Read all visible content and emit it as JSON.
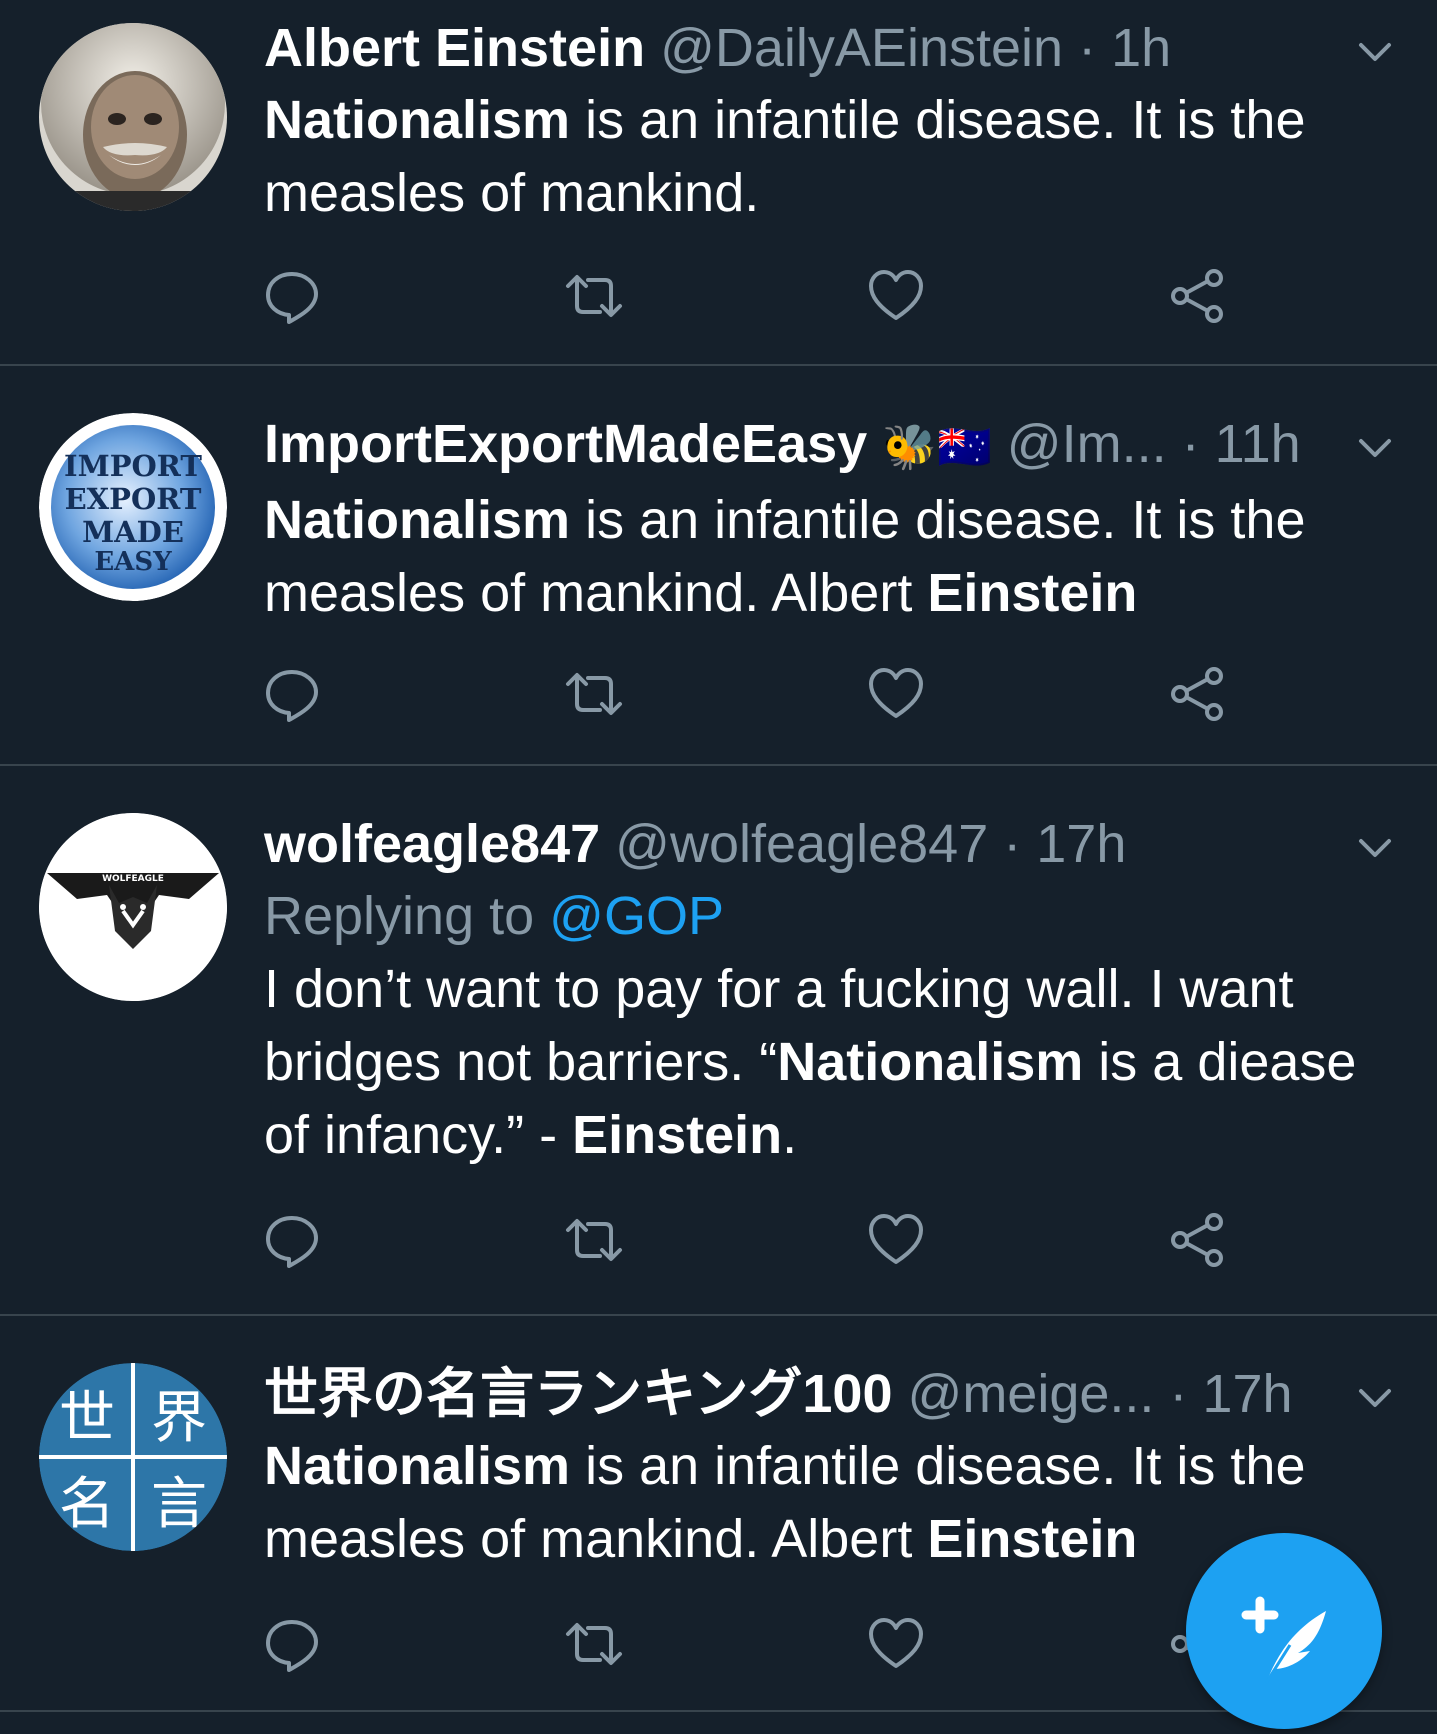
{
  "tweets": [
    {
      "name": "Albert Einstein",
      "handle": "@DailyAEinstein",
      "separator": "·",
      "time": "1h",
      "text_bold_1": "Nationalism",
      "text_1": " is an infantile disease. It is the measles of mankind."
    },
    {
      "name": "ImportExportMadeEasy",
      "name_emoji": "🐝🇦🇺",
      "handle": "@Im...",
      "separator": "·",
      "time": "11h",
      "text_bold_1": "Nationalism",
      "text_1": " is an infantile disease. It is the measles of mankind. Albert ",
      "text_bold_2": "Einstein",
      "avatar_lines": [
        "IMPORT",
        "EXPORT",
        "MADE",
        "EASY"
      ]
    },
    {
      "name": "wolfeagle847",
      "handle": "@wolfeagle847",
      "separator": "·",
      "time": "17h",
      "replying_prefix": "Replying to ",
      "replying_mention": "@GOP",
      "text_1": "I don’t want to pay for a fucking wall. I want bridges not barriers. “",
      "text_bold_1": "Nationalism",
      "text_2": " is a diease of infancy.” - ",
      "text_bold_2": "Einstein",
      "text_3": ".",
      "avatar_label": "WOLFEAGLE"
    },
    {
      "name": "世界の名言ランキング100",
      "handle": "@meige...",
      "separator": "·",
      "time": "17h",
      "text_bold_1": "Nationalism",
      "text_1": " is an infantile disease. It is the measles of mankind. Albert ",
      "text_bold_2": "Einstein",
      "avatar_chars": [
        "世",
        "界",
        "名",
        "言"
      ]
    }
  ],
  "icons": {
    "reply": "reply-icon",
    "retweet": "retweet-icon",
    "like": "heart-icon",
    "share": "share-icon",
    "more": "chevron-down-icon",
    "compose": "compose-quill-icon"
  },
  "colors": {
    "background": "#15202b",
    "divider": "#38444d",
    "secondary_text": "#8899a6",
    "accent": "#1da1f2",
    "primary_text": "#ffffff"
  }
}
